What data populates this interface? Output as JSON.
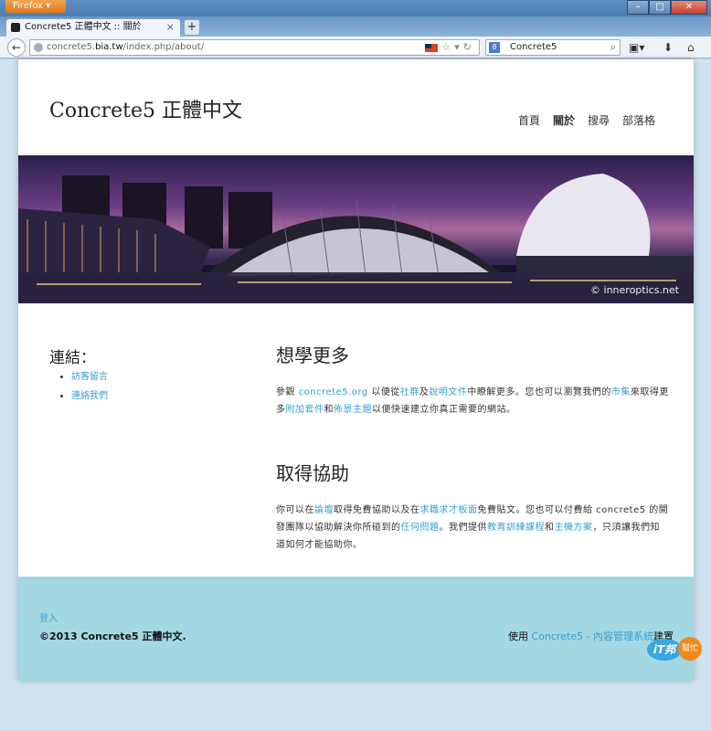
{
  "browser": {
    "app_button": "Firefox ▾",
    "tab_title": "Concrete5 正體中文 :: 關於",
    "new_tab": "+",
    "url_host_pre": "concrete5.",
    "url_host_bold": "bia.tw",
    "url_path": "/index.php/about/",
    "search_value": "Concrete5",
    "search_engine": "8"
  },
  "site": {
    "title": "Concrete5 正體中文",
    "nav": [
      "首頁",
      "關於",
      "搜尋",
      "部落格"
    ],
    "active_nav": "關於",
    "hero_credit": "© inneroptics.net"
  },
  "sidebar": {
    "title": "連結：",
    "links": [
      "訪客留言",
      "連絡我們"
    ]
  },
  "content": {
    "section1": {
      "title": "想學更多",
      "segments": [
        {
          "t": "參觀 ",
          "link": false
        },
        {
          "t": "concrete5.org",
          "link": true
        },
        {
          "t": " 以便從",
          "link": false
        },
        {
          "t": "社群",
          "link": true
        },
        {
          "t": "及",
          "link": false
        },
        {
          "t": "說明文件",
          "link": true
        },
        {
          "t": "中瞭解更多。您也可以瀏覽我們的",
          "link": false
        },
        {
          "t": "市集",
          "link": true
        },
        {
          "t": "來取得更多",
          "link": false
        },
        {
          "t": "附加套件",
          "link": true
        },
        {
          "t": "和",
          "link": false
        },
        {
          "t": "佈景主題",
          "link": true
        },
        {
          "t": "以便快速建立你真正需要的網站。",
          "link": false
        }
      ]
    },
    "section2": {
      "title": "取得協助",
      "segments": [
        {
          "t": "你可以在",
          "link": false
        },
        {
          "t": "論壇",
          "link": true
        },
        {
          "t": "取得免費協助以及在",
          "link": false
        },
        {
          "t": "求職求才板面",
          "link": true
        },
        {
          "t": "免費貼文。您也可以付費給 concrete5 的開發團隊以協助解決你所碰到的",
          "link": false
        },
        {
          "t": "任何問題",
          "link": true
        },
        {
          "t": "。我們提供",
          "link": false
        },
        {
          "t": "教育訓練課程",
          "link": true
        },
        {
          "t": "和",
          "link": false
        },
        {
          "t": "主機方案",
          "link": true
        },
        {
          "t": "，只須讓我們知道如何才能協助你。",
          "link": false
        }
      ]
    }
  },
  "footer": {
    "login": "登入",
    "copyright": "©2013 Concrete5 正體中文.",
    "powered_pre": "使用 ",
    "powered_link": "Concrete5 - 內容管理系統",
    "powered_post": "建置"
  },
  "badge": {
    "it": "iT邦",
    "help": "幫忙"
  },
  "colors": {
    "link": "#3a9fd0",
    "footer_bg": "#a3d8e3",
    "firefox_orange": "#e0761a"
  }
}
